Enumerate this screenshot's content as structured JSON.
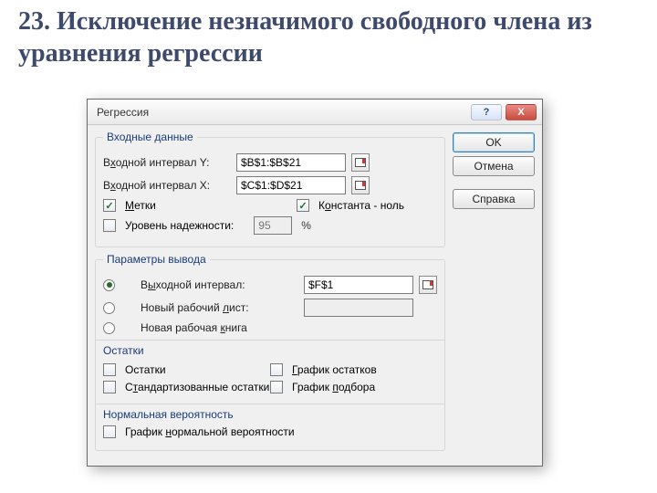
{
  "slide": {
    "title": "23. Исключение незначимого свободного члена из уравнения регрессии"
  },
  "dialog": {
    "title": "Регрессия",
    "buttons": {
      "ok": "OK",
      "cancel": "Отмена",
      "help": "Справка"
    },
    "help_glyph": "?",
    "close_glyph": "X"
  },
  "input_section": {
    "legend": "Входные данные",
    "y_label_pre": "В",
    "y_label_u": "х",
    "y_label_post": "одной интервал Y:",
    "y_value": "$B$1:$B$21",
    "x_label_pre": "В",
    "x_label_u": "х",
    "x_label_post": "одной интервал X:",
    "x_value": "$C$1:$D$21",
    "labels_cb_pre": "",
    "labels_cb_u": "М",
    "labels_cb_post": "етки",
    "labels_checked": true,
    "const_cb_pre": "К",
    "const_cb_u": "о",
    "const_cb_post": "нстанта - ноль",
    "const_checked": true,
    "conf_cb_pre": "Уровень надежности:",
    "conf_checked": false,
    "conf_value": "95",
    "conf_unit": "%"
  },
  "output_section": {
    "legend": "Параметры вывода",
    "out_range_label_pre": "В",
    "out_range_label_u": "ы",
    "out_range_label_post": "ходной интервал:",
    "out_range_value": "$F$1",
    "new_sheet_label_pre": "Новый рабочий ",
    "new_sheet_label_u": "л",
    "new_sheet_label_post": "ист:",
    "new_sheet_value": "",
    "new_book_label_pre": "Новая рабочая ",
    "new_book_label_u": "к",
    "new_book_label_post": "нига",
    "selected": "out_range"
  },
  "residuals": {
    "legend": "Остатки",
    "resid_label": "Остатки",
    "std_resid_label_pre": "С",
    "std_resid_label_u": "т",
    "std_resid_label_post": "андартизованные остатки",
    "resid_plot_label_pre": "",
    "resid_plot_label_u": "Г",
    "resid_plot_label_post": "рафик остатков",
    "fit_plot_label_pre": "График ",
    "fit_plot_label_u": "п",
    "fit_plot_label_post": "одбора"
  },
  "normal": {
    "legend": "Нормальная вероятность",
    "label_pre": "График ",
    "label_u": "н",
    "label_post": "ормальной вероятности"
  }
}
